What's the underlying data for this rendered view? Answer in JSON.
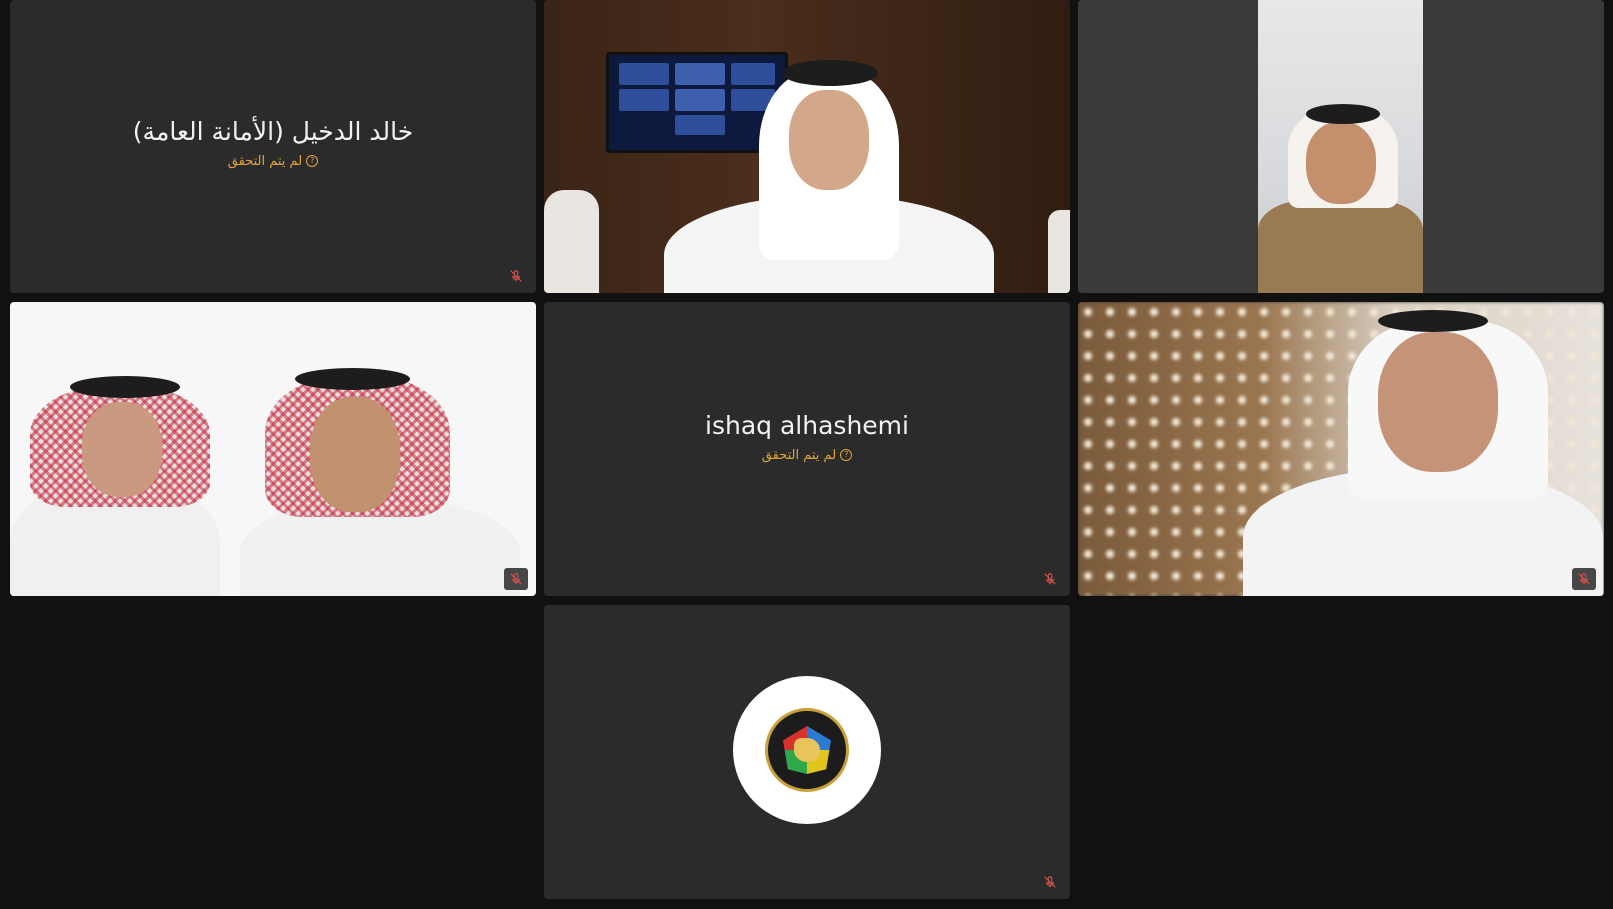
{
  "participants": [
    {
      "name": "خالد الدخيل (الأمانة العامة)",
      "status": "لم يتم التحقق",
      "camera": "off",
      "muted": true
    },
    {
      "camera": "on",
      "muted": false
    },
    {
      "camera": "on",
      "muted": false
    },
    {
      "camera": "on",
      "muted": true
    },
    {
      "name": "ishaq alhashemi",
      "status": "لم يتم التحقق",
      "camera": "off",
      "muted": true
    },
    {
      "camera": "on",
      "muted": true
    },
    {
      "camera": "off",
      "avatar": "gcc-emblem",
      "muted": true
    }
  ],
  "icons": {
    "status": "question-circle-icon",
    "mute": "mic-off-icon"
  },
  "colors": {
    "background": "#111111",
    "tile": "#2b2b2b",
    "status_text": "#e3a33a",
    "mute_icon": "#d9534f"
  }
}
